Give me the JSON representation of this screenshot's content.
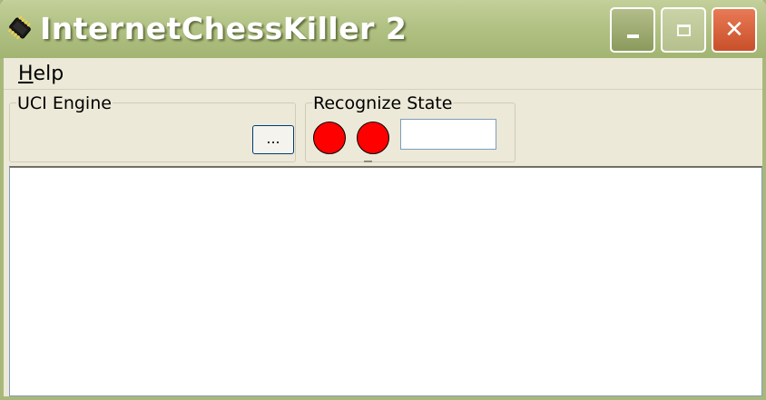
{
  "window": {
    "title": "InternetChessKiller 2",
    "icon": "chess-chip-icon",
    "controls": {
      "minimize": "minimize-icon",
      "maximize": "maximize-icon",
      "close": "close-icon",
      "close_glyph": "✕"
    }
  },
  "menu": {
    "help": {
      "label_ul": "H",
      "label_rest": "elp"
    }
  },
  "uci_engine": {
    "label": "UCI Engine",
    "browse_label": "..."
  },
  "recognize_state": {
    "label": "Recognize State",
    "indicators": [
      {
        "name": "indicator-1",
        "color": "#ff0000"
      },
      {
        "name": "indicator-2",
        "color": "#ff0000"
      }
    ],
    "field_value": ""
  },
  "output": {
    "text": ""
  },
  "colors": {
    "titlebar": "#b2c284",
    "close_button": "#d9623b",
    "window_bg": "#ece9d8",
    "indicator": "#ff0000"
  }
}
